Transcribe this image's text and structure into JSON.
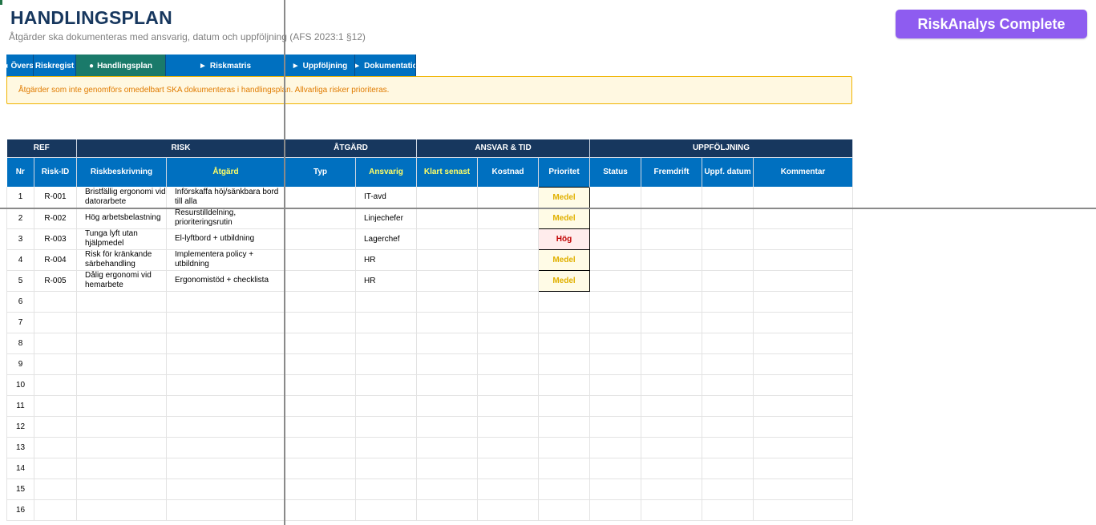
{
  "header": {
    "title": "HANDLINGSPLAN",
    "subtitle": "Åtgärder ska dokumenteras med ansvarig, datum och uppföljning (AFS 2023:1 §12)",
    "brand": "RiskAnalys Complete"
  },
  "nav": {
    "tabs": [
      {
        "label": "Översi",
        "glyph": "◂",
        "active": false
      },
      {
        "label": "Riskregist",
        "glyph": "",
        "active": false
      },
      {
        "label": "Handlingsplan",
        "glyph": "●",
        "active": true
      },
      {
        "label": "Riskmatris",
        "glyph": "►",
        "active": false
      },
      {
        "label": "Uppföljning",
        "glyph": "►",
        "active": false
      },
      {
        "label": "Dokumentatio",
        "glyph": "►",
        "active": false
      }
    ]
  },
  "notice": "Åtgärder som inte genomförs omedelbart SKA dokumenteras i handlingsplan. Allvarliga risker prioriteras.",
  "table": {
    "groups": [
      "REF",
      "RISK",
      "ÅTGÄRD",
      "ANSVAR & TID",
      "UPPFÖLJNING"
    ],
    "columns": [
      "Nr",
      "Risk-ID",
      "Riskbeskrivning",
      "Åtgärd",
      "Typ",
      "Ansvarig",
      "Klart senast",
      "Kostnad",
      "Prioritet",
      "Status",
      "Fremdrift",
      "Uppf. datum",
      "Kommentar"
    ],
    "rows": [
      {
        "nr": "1",
        "id": "R-001",
        "desc": "Bristfällig ergonomi vid datorarbete",
        "action": "Införskaffa höj/sänkbara bord till alla",
        "typ": "",
        "owner": "IT-avd",
        "due": "",
        "cost": "",
        "prio": "Medel",
        "status": "",
        "progress": "",
        "followup": "",
        "comment": ""
      },
      {
        "nr": "2",
        "id": "R-002",
        "desc": "Hög arbetsbelastning",
        "action": "Resurstilldelning, prioriteringsrutin",
        "typ": "",
        "owner": "Linjechefer",
        "due": "",
        "cost": "",
        "prio": "Medel",
        "status": "",
        "progress": "",
        "followup": "",
        "comment": ""
      },
      {
        "nr": "3",
        "id": "R-003",
        "desc": "Tunga lyft utan hjälpmedel",
        "action": "El-lyftbord + utbildning",
        "typ": "",
        "owner": "Lagerchef",
        "due": "",
        "cost": "",
        "prio": "Hög",
        "status": "",
        "progress": "",
        "followup": "",
        "comment": ""
      },
      {
        "nr": "4",
        "id": "R-004",
        "desc": "Risk för kränkande särbehandling",
        "action": "Implementera policy + utbildning",
        "typ": "",
        "owner": "HR",
        "due": "",
        "cost": "",
        "prio": "Medel",
        "status": "",
        "progress": "",
        "followup": "",
        "comment": ""
      },
      {
        "nr": "5",
        "id": "R-005",
        "desc": "Dålig ergonomi vid hemarbete",
        "action": "Ergonomistöd + checklista",
        "typ": "",
        "owner": "HR",
        "due": "",
        "cost": "",
        "prio": "Medel",
        "status": "",
        "progress": "",
        "followup": "",
        "comment": ""
      },
      {
        "nr": "6"
      },
      {
        "nr": "7"
      },
      {
        "nr": "8"
      },
      {
        "nr": "9"
      },
      {
        "nr": "10"
      },
      {
        "nr": "11"
      },
      {
        "nr": "12"
      },
      {
        "nr": "13"
      },
      {
        "nr": "14"
      },
      {
        "nr": "15"
      },
      {
        "nr": "16"
      }
    ]
  },
  "colors": {
    "title": "#17375e",
    "nav_tab": "#0070c0",
    "nav_active": "#1a7a6a",
    "group_header": "#17375e",
    "column_header": "#0070c0",
    "brand_button": "#8e5cf0",
    "notice_border": "#f0b400",
    "priority_medel": "#e0b000",
    "priority_hog": "#c00000"
  }
}
